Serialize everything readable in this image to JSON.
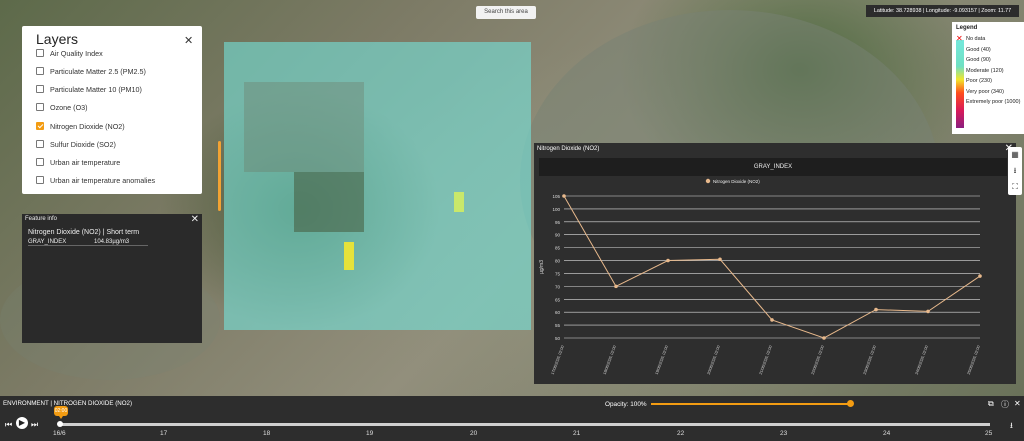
{
  "map": {
    "search_area_label": "Search this area",
    "coordinates_text": "Latitude: 38.728938 | Longitude: -9.093157 | Zoom: 11.77"
  },
  "legend": {
    "title": "Legend",
    "items": [
      "No data",
      "Good (40)",
      "Good (90)",
      "Moderate (120)",
      "Poor (230)",
      "Very poor (340)",
      "Extremely poor (1000)"
    ]
  },
  "layers_panel": {
    "title": "Layers",
    "items": [
      {
        "label": "Air Quality Index",
        "checked": false
      },
      {
        "label": "Particulate Matter 2.5 (PM2.5)",
        "checked": false
      },
      {
        "label": "Particulate Matter 10 (PM10)",
        "checked": false
      },
      {
        "label": "Ozone (O3)",
        "checked": false
      },
      {
        "label": "Nitrogen Dioxide (NO2)",
        "checked": true
      },
      {
        "label": "Sulfur Dioxide (SO2)",
        "checked": false
      },
      {
        "label": "Urban air temperature",
        "checked": false
      },
      {
        "label": "Urban air temperature anomalies",
        "checked": false
      }
    ]
  },
  "feature_info": {
    "title": "Feature info",
    "subtitle": "Nitrogen Dioxide (NO2) | Short term",
    "row_key": "GRAY_INDEX",
    "row_value": "104.83µg/m3"
  },
  "chart_panel": {
    "title": "Nitrogen Dioxide (NO2)",
    "band_label": "GRAY_INDEX"
  },
  "chart_data": {
    "type": "line",
    "x": [
      "17/06/2026, 02:00",
      "18/06/2026, 02:00",
      "19/06/2026, 02:00",
      "20/06/2026, 02:00",
      "21/06/2026, 02:00",
      "22/06/2026, 02:00",
      "23/06/2026, 02:00",
      "24/06/2026, 02:00",
      "25/06/2026, 02:00"
    ],
    "series": [
      {
        "name": "Nitrogen Dioxide (NO2)",
        "values": [
          105,
          70,
          80,
          80.5,
          57,
          50,
          61,
          60.3,
          74
        ],
        "color": "#e8b98c"
      }
    ],
    "title": "",
    "xlabel": "",
    "ylabel": "µg/m3",
    "y_ticks": [
      50,
      55,
      60,
      65,
      70,
      75,
      80,
      85,
      90,
      95,
      100,
      105
    ],
    "ylim": [
      50,
      105
    ],
    "grid": true,
    "legend_position": "top"
  },
  "bottom_bar": {
    "layer_label": "ENVIRONMENT | NITROGEN DIOXIDE (NO2)",
    "opacity_label": "Opacity: 100%",
    "current_time": "02:00",
    "current_date": "16/6",
    "ticks": [
      "17",
      "18",
      "19",
      "20",
      "21",
      "22",
      "23",
      "24",
      "25"
    ]
  }
}
